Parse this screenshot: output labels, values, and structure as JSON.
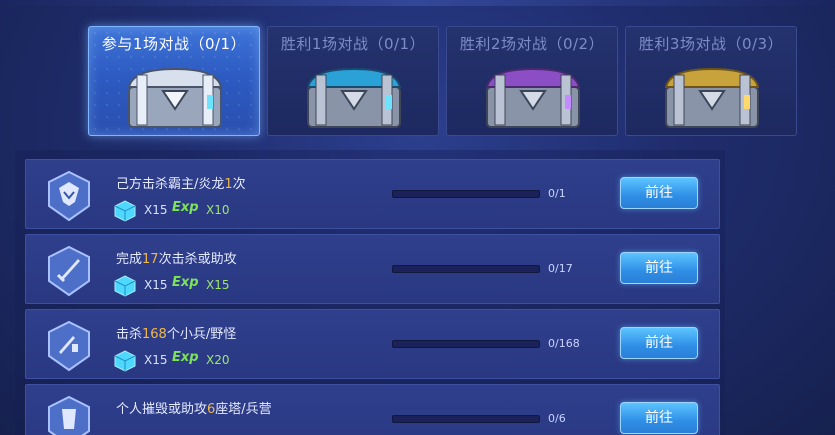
{
  "tabs": [
    {
      "label": "参与1场对战（0/1）",
      "active": true,
      "chest_color": "#c8d3e6"
    },
    {
      "label": "胜利1场对战（0/1）",
      "active": false,
      "chest_color": "#2aa2d8"
    },
    {
      "label": "胜利2场对战（0/2）",
      "active": false,
      "chest_color": "#8b4ec4"
    },
    {
      "label": "胜利3场对战（0/3）",
      "active": false,
      "chest_color": "#c8a23a"
    }
  ],
  "tasks": [
    {
      "title_pre": "己方击杀霸主/炎龙",
      "title_num": "1",
      "title_post": "次",
      "cube_qty": "X15",
      "exp_label": "Exp",
      "exp_qty": "X10",
      "progress": "0/1",
      "progress_value": 0,
      "button": "前往"
    },
    {
      "title_pre": "完成",
      "title_num": "17",
      "title_post": "次击杀或助攻",
      "cube_qty": "X15",
      "exp_label": "Exp",
      "exp_qty": "X15",
      "progress": "0/17",
      "progress_value": 0,
      "button": "前往"
    },
    {
      "title_pre": "击杀",
      "title_num": "168",
      "title_post": "个小兵/野怪",
      "cube_qty": "X15",
      "exp_label": "Exp",
      "exp_qty": "X20",
      "progress": "0/168",
      "progress_value": 0,
      "button": "前往"
    },
    {
      "title_pre": "个人摧毁或助攻",
      "title_num": "6",
      "title_post": "座塔/兵营",
      "cube_qty": "",
      "exp_label": "",
      "exp_qty": "",
      "progress": "0/6",
      "progress_value": 0,
      "button": "前往"
    }
  ],
  "colors": {
    "accent_orange": "#f0b84a",
    "button_blue": "#2f8ee6",
    "exp_green": "#7ee25a"
  }
}
